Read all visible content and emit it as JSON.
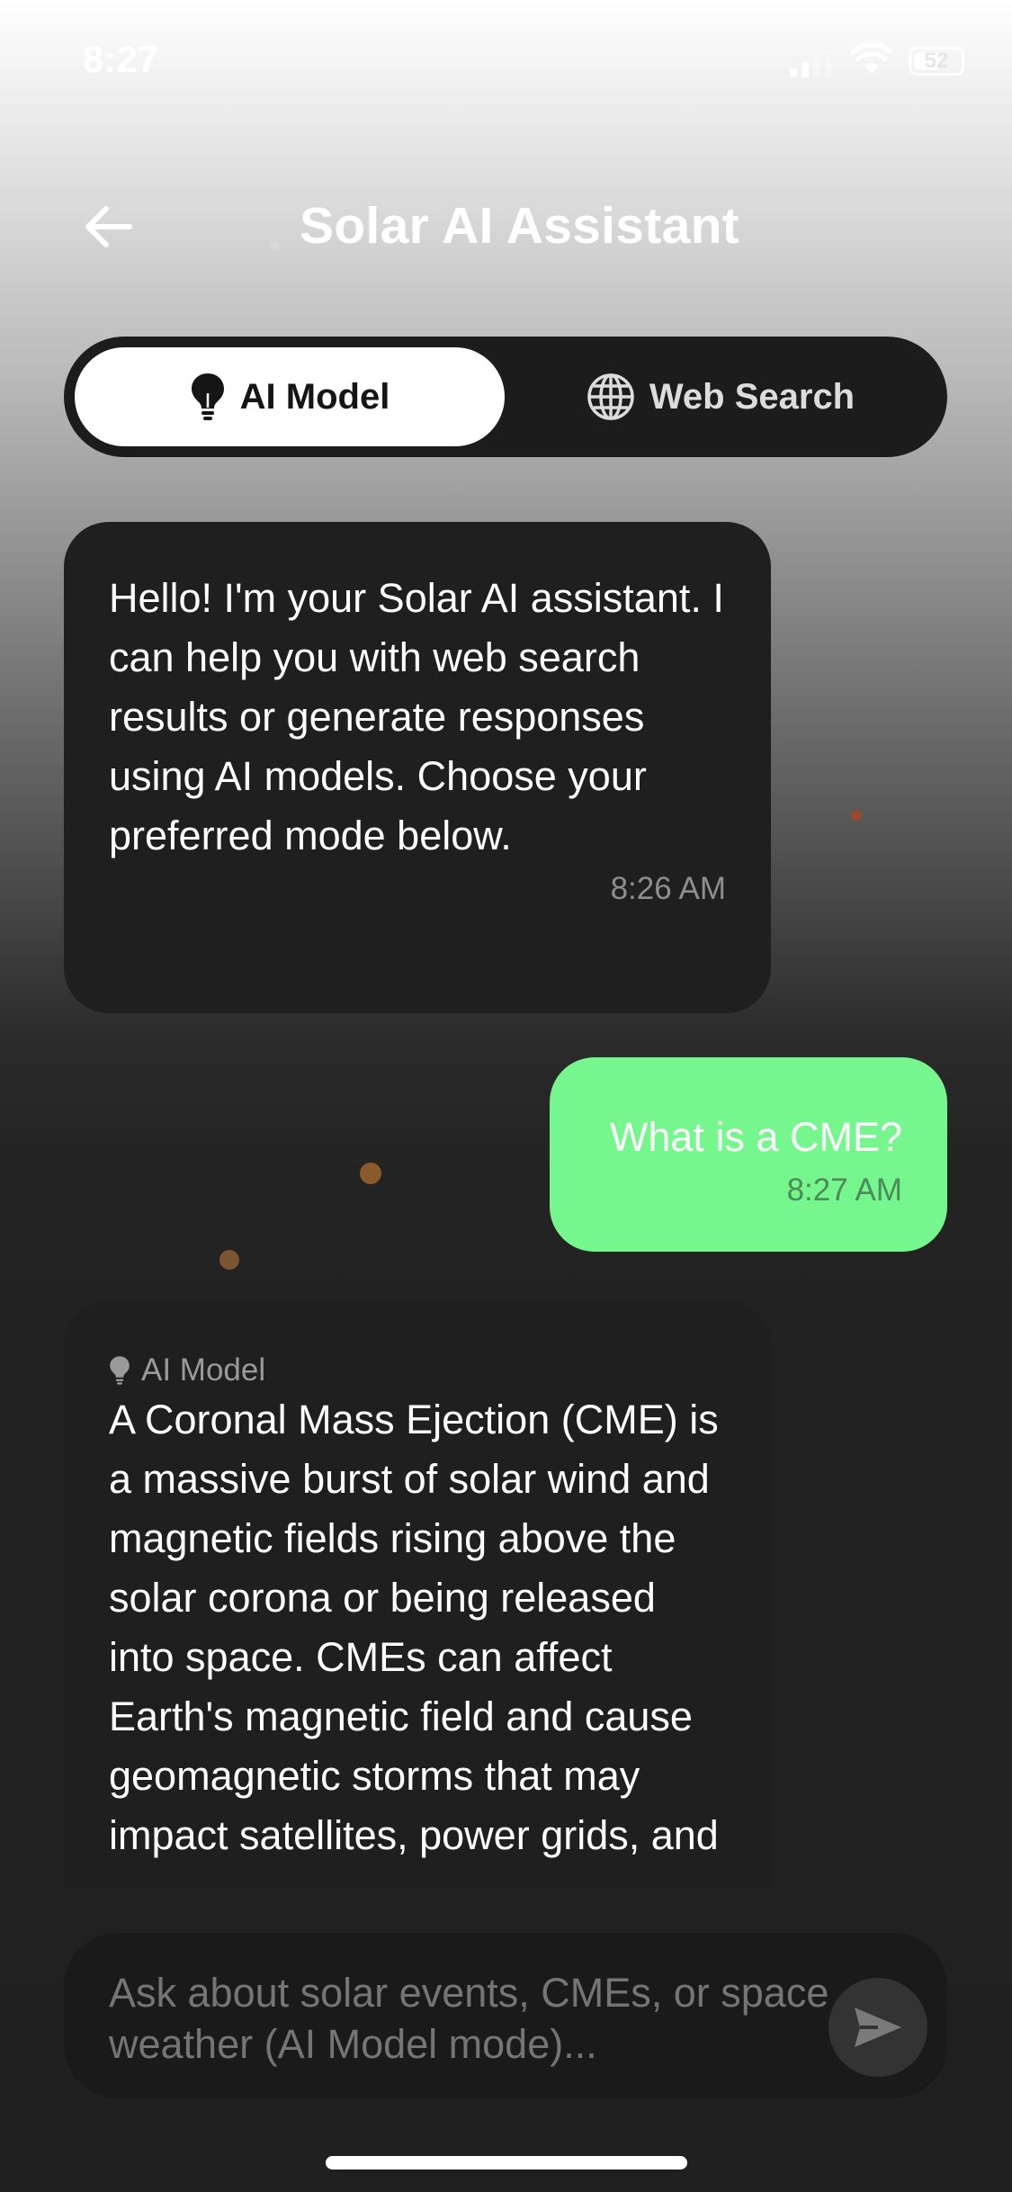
{
  "status_bar": {
    "time": "8:27",
    "battery_level": "52",
    "icons": [
      "signal-icon",
      "wifi-icon",
      "battery-icon"
    ]
  },
  "header": {
    "back_icon": "arrow-left-icon",
    "title": "Solar AI Assistant"
  },
  "mode_switch": {
    "selected": "ai_model",
    "tabs": [
      {
        "id": "ai_model",
        "label": "AI Model",
        "icon": "lightbulb-icon"
      },
      {
        "id": "web_search",
        "label": "Web Search",
        "icon": "globe-icon"
      }
    ]
  },
  "messages": [
    {
      "role": "assistant",
      "text": "Hello! I'm your Solar AI assistant. I can help you with web search results or generate responses using AI models. Choose your preferred mode below.",
      "time": "8:26 AM"
    },
    {
      "role": "user",
      "text": "What is a CME?",
      "time": "8:27 AM"
    },
    {
      "role": "assistant",
      "source_label": "AI Model",
      "source_icon": "lightbulb-icon",
      "text": "A Coronal Mass Ejection (CME) is a massive burst of solar wind and magnetic fields rising above the solar corona or being released into space. CMEs can affect Earth's magnetic field and cause geomagnetic storms that may impact satellites, power grids, and"
    }
  ],
  "composer": {
    "placeholder": "Ask about solar events, CMEs, or space weather (AI Model mode)...",
    "send_icon": "send-icon"
  },
  "colors": {
    "user_bubble": "#76f78e",
    "assistant_bubble": "#1f1f1f",
    "switch_background": "#1c1c1c",
    "active_tab": "#ffffff"
  }
}
